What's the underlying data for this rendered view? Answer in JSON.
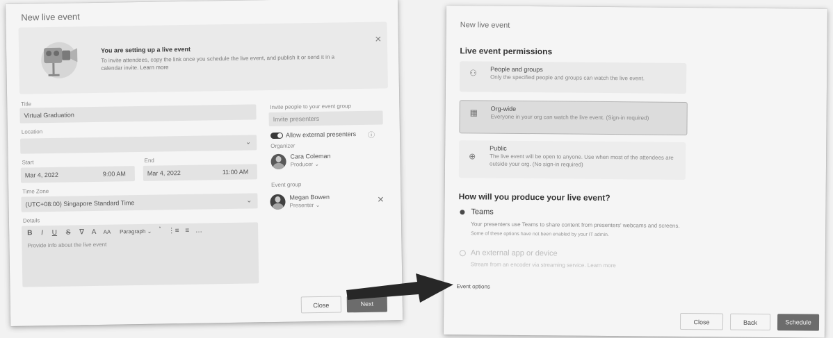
{
  "left_dialog": {
    "title": "New live event",
    "banner": {
      "heading": "You are setting up a live event",
      "body": "To invite attendees, copy the link once you schedule the live event, and publish it or send it in a",
      "body2": "calendar invite.",
      "learn_more": "Learn more"
    },
    "title_label": "Title",
    "title_value": "Virtual Graduation",
    "location_label": "Location",
    "start_label": "Start",
    "start_date": "Mar 4, 2022",
    "start_time": "9:00 AM",
    "end_label": "End",
    "end_date": "Mar 4, 2022",
    "end_time": "11:00 AM",
    "timezone_label": "Time Zone",
    "timezone_value": "(UTC+08:00) Singapore Standard Time",
    "details_label": "Details",
    "details_placeholder": "Provide info about the live event",
    "toolbar": {
      "bold": "B",
      "italic": "I",
      "underline": "U",
      "strike": "S",
      "paragraph": "Paragraph"
    },
    "invite_label": "Invite people to your event group",
    "invite_placeholder": "Invite presenters",
    "external_toggle_label": "Allow external presenters",
    "organizer_label": "Organizer",
    "organizer_name": "Cara Coleman",
    "organizer_role": "Producer",
    "event_group_label": "Event group",
    "presenter_name": "Megan Bowen",
    "presenter_role": "Presenter",
    "close_label": "Close",
    "next_label": "Next"
  },
  "right_dialog": {
    "title": "New live event",
    "permissions_heading": "Live event permissions",
    "permissions": [
      {
        "title": "People and groups",
        "desc": "Only the specified people and groups can watch the live event.",
        "icon": "people-icon"
      },
      {
        "title": "Org-wide",
        "desc": "Everyone in your org can watch the live event. (Sign-in required)",
        "icon": "org-icon"
      },
      {
        "title": "Public",
        "desc": "The live event will be open to anyone. Use when most of the attendees are outside your org. (No sign-in required)",
        "icon": "globe-icon"
      }
    ],
    "produce_heading": "How will you produce your live event?",
    "teams_title": "Teams",
    "teams_desc": "Your presenters use Teams to share content from presenters' webcams and screens.",
    "teams_note": "Some of these options have not been enabled by your IT admin.",
    "external_title": "An external app or device",
    "external_desc": "Stream from an encoder via streaming service.",
    "external_link": "Learn more",
    "event_options_label": "Event options",
    "close_label": "Close",
    "back_label": "Back",
    "schedule_label": "Schedule"
  }
}
